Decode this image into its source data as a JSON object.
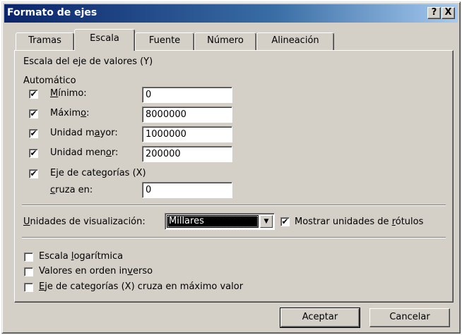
{
  "window": {
    "title": "Formato de ejes",
    "help_label": "?",
    "close_label": "X"
  },
  "tabs": [
    {
      "label": "Tramas",
      "active": false
    },
    {
      "label": "Escala",
      "active": true
    },
    {
      "label": "Fuente",
      "active": false
    },
    {
      "label": "Número",
      "active": false
    },
    {
      "label": "Alineación",
      "active": false
    }
  ],
  "scale": {
    "heading": "Escala del eje de valores (Y)",
    "auto_label": "Automático",
    "rows": [
      {
        "label_pre": "",
        "label_u": "M",
        "label_post": "ínimo:",
        "checked": true,
        "value": "0"
      },
      {
        "label_pre": "Máxim",
        "label_u": "o",
        "label_post": ":",
        "checked": true,
        "value": "8000000"
      },
      {
        "label_pre": "Unidad m",
        "label_u": "a",
        "label_post": "yor:",
        "checked": true,
        "value": "1000000"
      },
      {
        "label_pre": "Unidad men",
        "label_u": "o",
        "label_post": "r:",
        "checked": true,
        "value": "200000"
      }
    ],
    "cross": {
      "label": "Eje de categorías (X)",
      "checked": true,
      "sub_u": "c",
      "sub_rest": "ruza en:",
      "value": "0"
    }
  },
  "display_units": {
    "label_u": "U",
    "label_rest": "nidades de visualización:",
    "value": "Millares",
    "show_pre": "Mostrar unidades de ",
    "show_u": "r",
    "show_post": "ótulos",
    "show_checked": true
  },
  "options": [
    {
      "pre": "Escala ",
      "u": "l",
      "post": "ogarítmica",
      "checked": false
    },
    {
      "pre": "Valores en orden in",
      "u": "v",
      "post": "erso",
      "checked": false
    },
    {
      "pre": "",
      "u": "E",
      "post": "je de categorías (X) cruza en máximo valor",
      "checked": false
    }
  ],
  "buttons": {
    "ok": "Aceptar",
    "cancel": "Cancelar"
  },
  "check_mark": "✔"
}
